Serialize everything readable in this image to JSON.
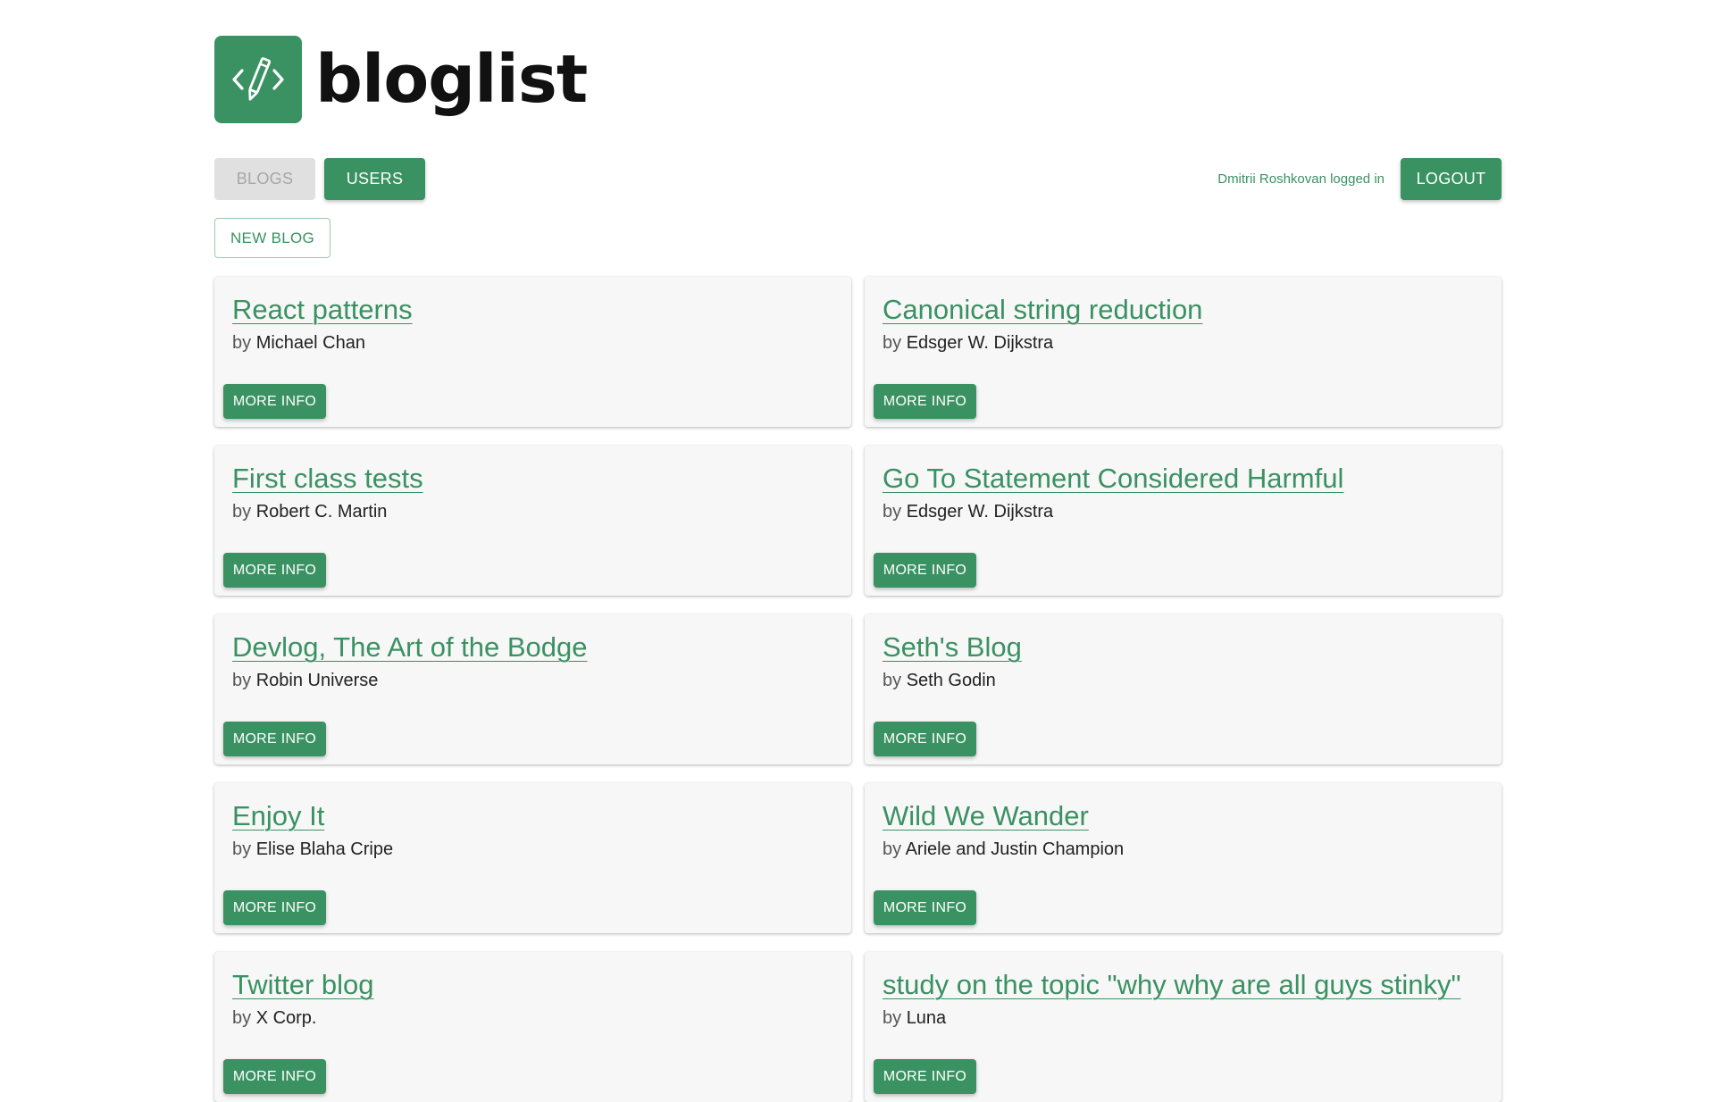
{
  "app": {
    "name": "bloglist",
    "logo_icon": "code-pencil-icon",
    "accent": "#3a9162"
  },
  "nav": {
    "blogs_label": "BLOGS",
    "users_label": "USERS"
  },
  "session": {
    "user_text": "Dmitrii Roshkovan logged in",
    "logout_label": "LOGOUT"
  },
  "actions": {
    "new_blog_label": "NEW BLOG"
  },
  "blogs": [
    {
      "title": "React patterns",
      "by": "by",
      "author": "Michael Chan",
      "more_label": "MORE INFO"
    },
    {
      "title": "Canonical string reduction",
      "by": "by",
      "author": "Edsger W. Dijkstra",
      "more_label": "MORE INFO"
    },
    {
      "title": "First class tests",
      "by": "by",
      "author": "Robert C. Martin",
      "more_label": "MORE INFO"
    },
    {
      "title": "Go To Statement Considered Harmful",
      "by": "by",
      "author": "Edsger W. Dijkstra",
      "more_label": "MORE INFO"
    },
    {
      "title": "Devlog, The Art of the Bodge",
      "by": "by",
      "author": "Robin Universe",
      "more_label": "MORE INFO"
    },
    {
      "title": "Seth's Blog",
      "by": "by",
      "author": "Seth Godin",
      "more_label": "MORE INFO"
    },
    {
      "title": "Enjoy It",
      "by": "by",
      "author": "Elise Blaha Cripe",
      "more_label": "MORE INFO"
    },
    {
      "title": "Wild We Wander",
      "by": "by",
      "author": "Ariele and Justin Champion",
      "more_label": "MORE INFO"
    },
    {
      "title": "Twitter blog",
      "by": "by",
      "author": "X Corp.",
      "more_label": "MORE INFO"
    },
    {
      "title": "study on the topic \"why why are all guys stinky\"",
      "by": "by",
      "author": "Luna",
      "more_label": "MORE INFO"
    }
  ]
}
